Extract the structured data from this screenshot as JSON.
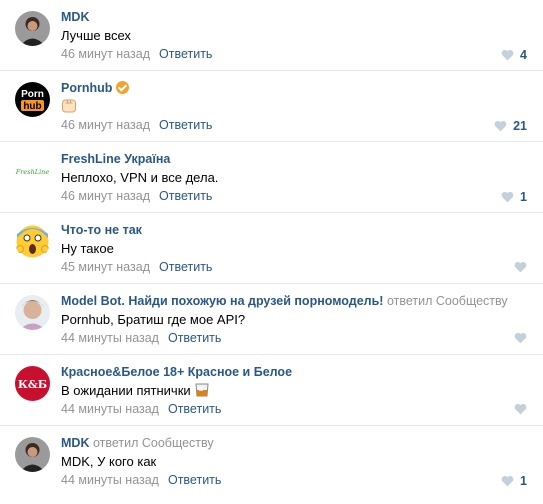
{
  "comments": [
    {
      "author": "MDK",
      "meta": "",
      "text": "Лучше всех",
      "time": "46 минут назад",
      "reply": "Ответить",
      "likes": "4"
    },
    {
      "author": "Pornhub",
      "meta": "",
      "text": "",
      "time": "46 минут назад",
      "reply": "Ответить",
      "likes": "21",
      "avatar_text_top": "Porn",
      "avatar_text_bottom": "hub"
    },
    {
      "author": "FreshLine Україна",
      "meta": "",
      "text": "Неплохо, VPN и все дела.",
      "time": "46 минут назад",
      "reply": "Ответить",
      "likes": "1",
      "avatar_text": "FreshLine"
    },
    {
      "author": "Что-то не так",
      "meta": "",
      "text": "Ну такое",
      "time": "45 минут назад",
      "reply": "Ответить",
      "likes": ""
    },
    {
      "author": "Model Bot. Найди похожую на друзей порномодель!",
      "meta": "ответил Сообществу",
      "text": "Pornhub, Братиш где мое API?",
      "time": "44 минуты назад",
      "reply": "Ответить",
      "likes": ""
    },
    {
      "author": "Красное&Белое 18+ Красное и Белое",
      "meta": "",
      "text": "В ожидании пятнички",
      "time": "44 минуты назад",
      "reply": "Ответить",
      "likes": "",
      "avatar_text": "К&Б"
    },
    {
      "author": "MDK",
      "meta": "ответил Сообществу",
      "text": "MDK, У кого как",
      "time": "44 минуты назад",
      "reply": "Ответить",
      "likes": "1"
    }
  ],
  "colors": {
    "link": "#2a5885",
    "meta": "#939393",
    "heart": "#c4d0dc",
    "divider": "#e7e8ec",
    "verified": "#f1a330",
    "pornhub_orange": "#f7971d",
    "kb_red": "#c8102e"
  }
}
